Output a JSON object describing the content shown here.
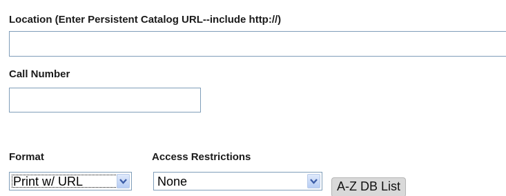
{
  "location": {
    "label": "Location (Enter Persistent Catalog URL--include http://)",
    "value": ""
  },
  "call_number": {
    "label": "Call Number",
    "value": ""
  },
  "format": {
    "label": "Format",
    "selected": "Print w/ URL"
  },
  "access_restrictions": {
    "label": "Access Restrictions",
    "selected": "None"
  },
  "az_button": {
    "label": "A-Z DB List"
  },
  "icons": {
    "dropdown": "chevron-down-icon"
  }
}
